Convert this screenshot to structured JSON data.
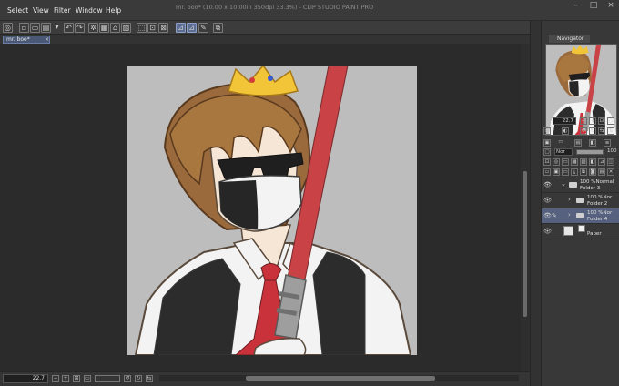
{
  "menu": [
    "Select",
    "View",
    "Filter",
    "Window",
    "Help"
  ],
  "window_title": "mr. boo* (10.00 x 10.00in 350dpi 33.3%) - CLIP STUDIO PAINT PRO",
  "document_tab": {
    "label": "mr. boo*",
    "close": "×"
  },
  "canvas": {
    "zoom": "33.3",
    "background_color": "#bdbdbd"
  },
  "status": {
    "zoom_value": "22.7"
  },
  "navigator": {
    "tab_label": "Navigator",
    "zoom_value": "22.7"
  },
  "layer_properties": {
    "blend_mode": "Nor",
    "opacity_value": "100",
    "opacity_fraction": 1.0
  },
  "layers": [
    {
      "name": "Folder 3",
      "opacity": "100 %",
      "blend": "Normal",
      "kind": "folder",
      "selected": false
    },
    {
      "name": "Folder 2",
      "opacity": "100 %",
      "blend": "Nor",
      "kind": "folder",
      "selected": false
    },
    {
      "name": "Folder 4",
      "opacity": "100 %",
      "blend": "Nor",
      "kind": "folder",
      "selected": true
    },
    {
      "name": "Paper",
      "opacity": "",
      "blend": "",
      "kind": "paper",
      "selected": false
    }
  ],
  "window_controls": {
    "minimize": "–",
    "maximize": "□",
    "close": "×"
  },
  "icons": {
    "eye": "👁",
    "pen": "✎",
    "chevron": "›"
  }
}
